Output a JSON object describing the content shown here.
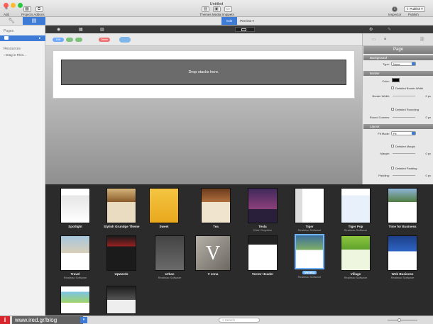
{
  "window": {
    "title": "Untitled"
  },
  "toolbar": {
    "add": "Add",
    "projects": "Projects",
    "addons": "Addons",
    "themes": "Themes",
    "media": "Media",
    "snippets": "Snippets",
    "inspector": "Inspector",
    "publish": "Publish",
    "publish_btn": "Publish"
  },
  "mode": {
    "edit": "Edit",
    "preview": "Preview"
  },
  "sidebar": {
    "pages_header": "Pages",
    "resources_header": "Resources",
    "drag_files": "Drag in Files..."
  },
  "canvas": {
    "drop_text": "Drop stacks here."
  },
  "inspector": {
    "title": "Page",
    "background": {
      "header": "Background",
      "type_label": "Type:",
      "type_value": "None"
    },
    "border": {
      "header": "Border",
      "color_label": "Color:",
      "detailed_width": "Detailed Border Width",
      "width_label": "Border Width:",
      "width_value": "0 px",
      "detailed_rounding": "Detailed Rounding",
      "corners_label": "Round Corners:",
      "corners_value": "0 px"
    },
    "layout": {
      "header": "Layout",
      "fit_label": "Fit Mode:",
      "fit_value": "Fit",
      "detailed_margin": "Detailed Margin",
      "margin_label": "Margin:",
      "margin_value": "0 px",
      "detailed_padding": "Detailed Padding",
      "padding_label": "Padding:",
      "padding_value": "0 px"
    }
  },
  "themes": [
    {
      "name": "Spotlight",
      "sub": ""
    },
    {
      "name": "Stylish Grundge Theme",
      "sub": ""
    },
    {
      "name": "Sweet",
      "sub": ""
    },
    {
      "name": "Tea",
      "sub": ""
    },
    {
      "name": "Tesla",
      "sub": "Elixir Graphics"
    },
    {
      "name": "Tiger",
      "sub": "Realmac Software"
    },
    {
      "name": "Tiger Pop",
      "sub": "Realmac Software"
    },
    {
      "name": "Time for Business",
      "sub": ""
    },
    {
      "name": "Travel",
      "sub": "Realmac Software"
    },
    {
      "name": "Upwards",
      "sub": ""
    },
    {
      "name": "Urban",
      "sub": "Realmac Software"
    },
    {
      "name": "V enna",
      "sub": ""
    },
    {
      "name": "Vector Header",
      "sub": ""
    },
    {
      "name": "Vesela",
      "sub": "Realmac Software"
    },
    {
      "name": "Village",
      "sub": "Realmac Software"
    },
    {
      "name": "Web Business",
      "sub": "Realmac Software"
    }
  ],
  "footer": {
    "search_placeholder": "Search",
    "watermark": "www.ired.gr/blog",
    "brand_letter": "i"
  },
  "colors": {
    "accent": "#3d7bd6",
    "selected_theme": "#6fb5ff",
    "brand": "#d9262c"
  }
}
